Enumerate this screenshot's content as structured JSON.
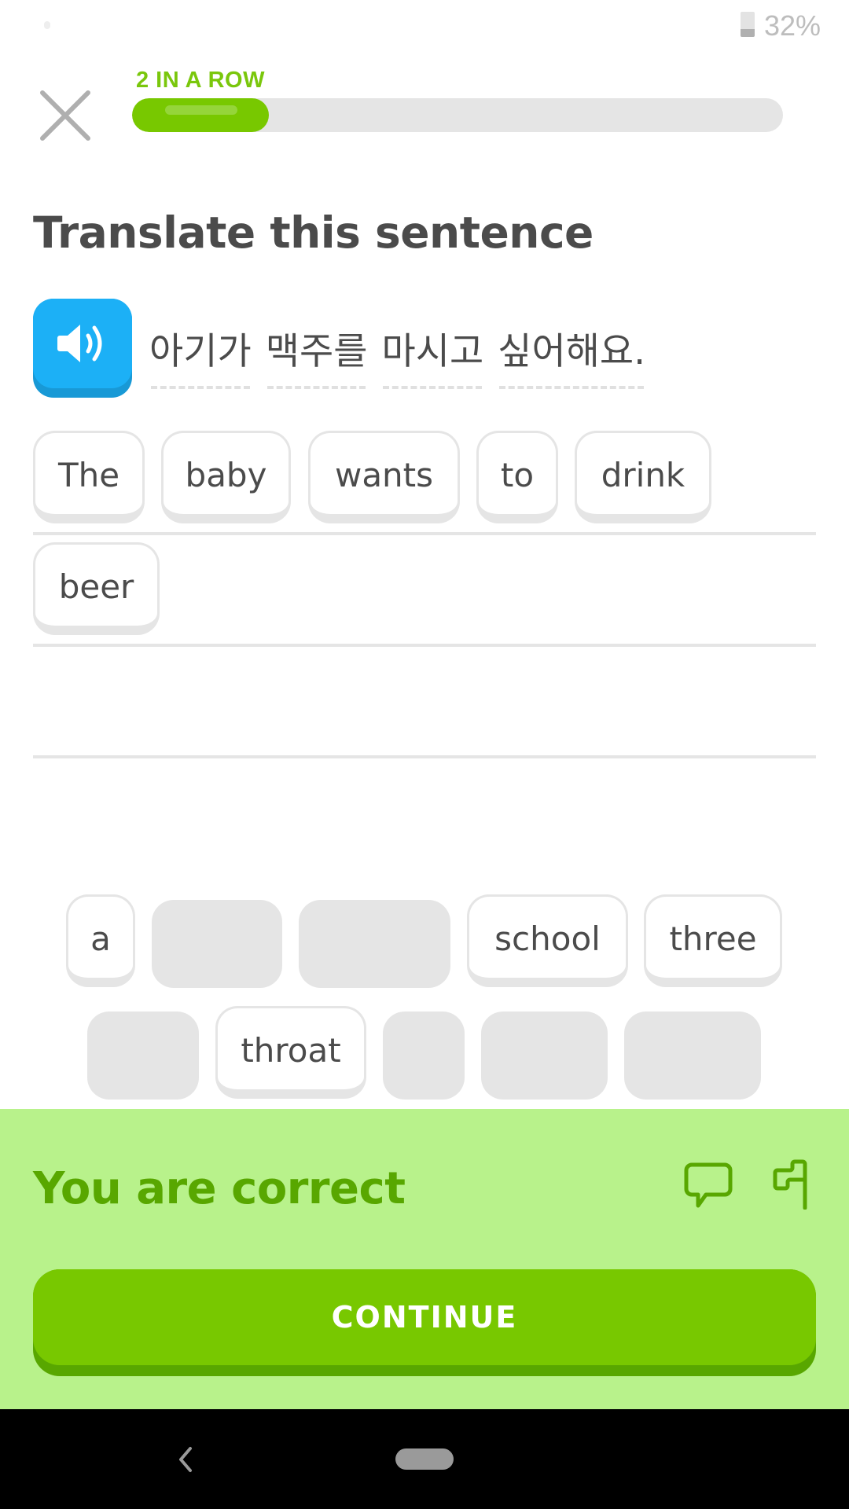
{
  "status_bar": {
    "battery_percent_text": "32%",
    "battery_level": 0.32
  },
  "header": {
    "close_icon": "close-icon",
    "streak_label": "2 IN A ROW",
    "progress_fraction": 0.21
  },
  "challenge": {
    "title": "Translate this sentence",
    "speaker_icon": "speaker-icon",
    "prompt_words": [
      "아기가",
      "맥주를",
      "마시고",
      "싶어해요."
    ]
  },
  "answer": {
    "chips": [
      "The",
      "baby",
      "wants",
      "to",
      "drink",
      "beer"
    ]
  },
  "word_bank": {
    "row1": [
      {
        "label": "a",
        "used": false
      },
      {
        "label": "",
        "used": true
      },
      {
        "label": "",
        "used": true
      },
      {
        "label": "school",
        "used": false
      },
      {
        "label": "three",
        "used": false
      }
    ],
    "row2": [
      {
        "label": "",
        "used": true
      },
      {
        "label": "throat",
        "used": false
      },
      {
        "label": "",
        "used": true
      },
      {
        "label": "",
        "used": true
      },
      {
        "label": "",
        "used": true
      }
    ]
  },
  "feedback": {
    "title": "You are correct",
    "discuss_icon": "comment-icon",
    "report_icon": "flag-icon",
    "continue_label": "CONTINUE"
  },
  "colors": {
    "accent_green": "#78C800",
    "dark_green": "#58A700",
    "feedback_bg": "#B8F28B",
    "speaker_blue": "#1CB0F6",
    "text_gray": "#4B4B4B",
    "border_gray": "#E5E5E5"
  }
}
